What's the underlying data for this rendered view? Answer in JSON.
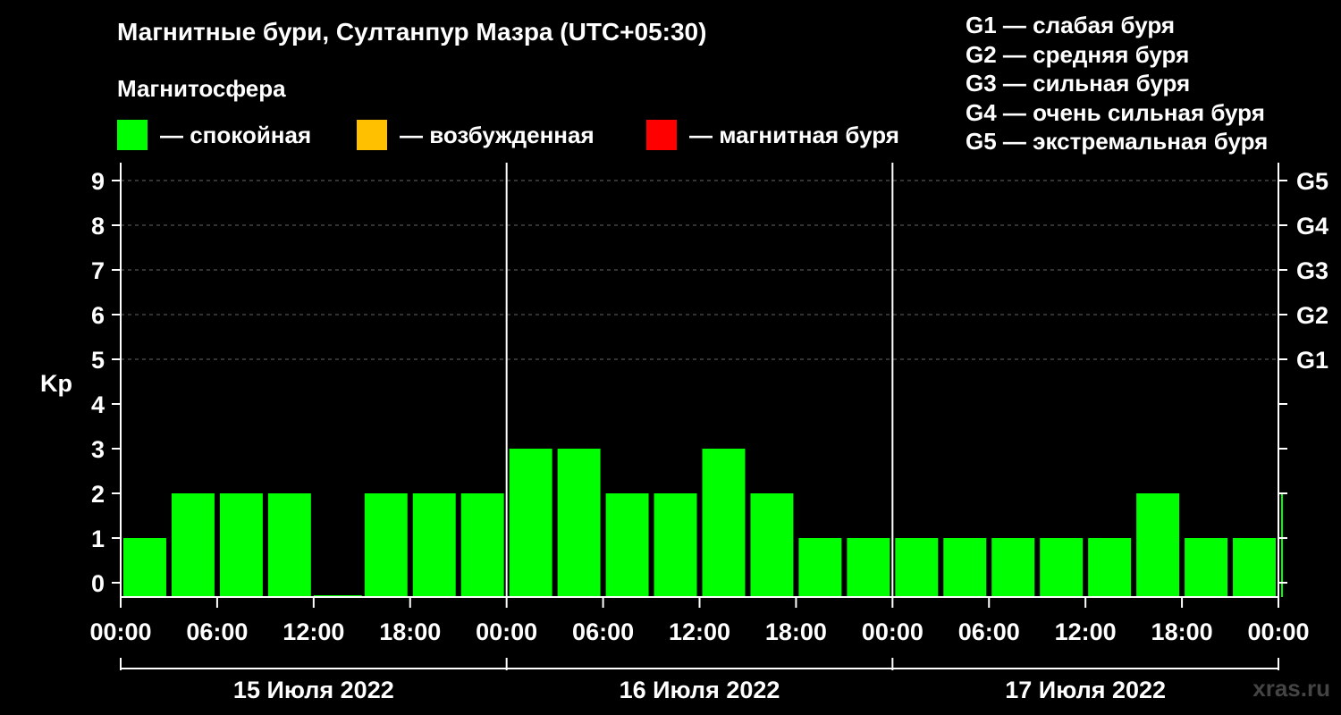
{
  "title": "Магнитные бури, Султанпур Мазра (UTC+05:30)",
  "subtitle": "Магнитосфера",
  "legend": [
    {
      "label": "— спокойная",
      "color": "#00ff00"
    },
    {
      "label": "— возбужденная",
      "color": "#ffc000"
    },
    {
      "label": "— магнитная буря",
      "color": "#ff0000"
    }
  ],
  "storm_levels": [
    "G1 — слабая буря",
    "G2 — средняя буря",
    "G3 — сильная буря",
    "G4 — очень сильная буря",
    "G5 — экстремальная буря"
  ],
  "watermark": "xras.ru",
  "chart_data": {
    "type": "bar",
    "ylabel": "Kp",
    "ylim": [
      0,
      9
    ],
    "yticks": [
      "0",
      "1",
      "2",
      "3",
      "4",
      "5",
      "6",
      "7",
      "8",
      "9"
    ],
    "right_ticks": [
      {
        "value": 5,
        "label": "G1"
      },
      {
        "value": 6,
        "label": "G2"
      },
      {
        "value": 7,
        "label": "G3"
      },
      {
        "value": 8,
        "label": "G4"
      },
      {
        "value": 9,
        "label": "G5"
      }
    ],
    "xtick_labels": [
      "00:00",
      "06:00",
      "12:00",
      "18:00",
      "00:00",
      "06:00",
      "12:00",
      "18:00",
      "00:00",
      "06:00",
      "12:00",
      "18:00",
      "00:00"
    ],
    "days": [
      "15 Июля 2022",
      "16 Июля 2022",
      "17 Июля 2022"
    ],
    "grid": true,
    "bar_color": "#00ff00",
    "bars": [
      {
        "start_hour": 0,
        "value": 1
      },
      {
        "start_hour": 3,
        "value": 2
      },
      {
        "start_hour": 6,
        "value": 2
      },
      {
        "start_hour": 9,
        "value": 2
      },
      {
        "start_hour": 12,
        "value": 0
      },
      {
        "start_hour": 15,
        "value": 2
      },
      {
        "start_hour": 18,
        "value": 2
      },
      {
        "start_hour": 21,
        "value": 2
      },
      {
        "start_hour": 24,
        "value": 3
      },
      {
        "start_hour": 27,
        "value": 3
      },
      {
        "start_hour": 30,
        "value": 2
      },
      {
        "start_hour": 33,
        "value": 2
      },
      {
        "start_hour": 36,
        "value": 3
      },
      {
        "start_hour": 39,
        "value": 2
      },
      {
        "start_hour": 42,
        "value": 1
      },
      {
        "start_hour": 45,
        "value": 1
      },
      {
        "start_hour": 48,
        "value": 1
      },
      {
        "start_hour": 51,
        "value": 1
      },
      {
        "start_hour": 54,
        "value": 1
      },
      {
        "start_hour": 57,
        "value": 1
      },
      {
        "start_hour": 60,
        "value": 1
      },
      {
        "start_hour": 63,
        "value": 2
      },
      {
        "start_hour": 66,
        "value": 1
      },
      {
        "start_hour": 69,
        "value": 1
      },
      {
        "start_hour": 72,
        "value": 2
      }
    ]
  }
}
